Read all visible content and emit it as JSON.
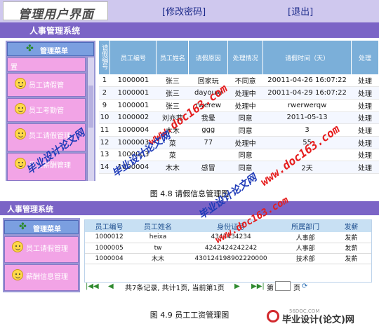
{
  "figure1": {
    "logo_text": "管理用户界面",
    "links": {
      "change_password": "[修改密码]",
      "logout": "[退出]"
    },
    "system_title": "人事管理系统",
    "sidebar": {
      "header": "管理菜单",
      "items": [
        {
          "label": "置"
        },
        {
          "label": "员工请假管"
        },
        {
          "label": "员工考勤管"
        },
        {
          "label": "员工请假管理"
        },
        {
          "label": "员工薪酬管理"
        }
      ]
    },
    "table": {
      "headers": [
        "请假编号",
        "员工编号",
        "员工姓名",
        "请假原因",
        "处理情况",
        "请假时间（天）",
        "处理"
      ],
      "rows": [
        [
          "1",
          "1000001",
          "张三",
          "回家玩",
          "不同意",
          "20011-04-26 16:07:22",
          "处理"
        ],
        [
          "2",
          "1000001",
          "张三",
          "dayouxi",
          "处理中",
          "20011-04-29 16:07:22",
          "处理"
        ],
        [
          "9",
          "1000001",
          "张三",
          "rwerew",
          "处理中",
          "rwerwerqw",
          "处理"
        ],
        [
          "10",
          "1000002",
          "刘亦菲",
          "我晕",
          "同意",
          "2011-05-13",
          "处理"
        ],
        [
          "11",
          "1000004",
          "木木",
          "ggg",
          "同意",
          "3",
          "处理"
        ],
        [
          "12",
          "1000003",
          "菜",
          "77",
          "处理中",
          "55",
          "处理"
        ],
        [
          "13",
          "1000003",
          "菜",
          "",
          "同意",
          "",
          "处理"
        ],
        [
          "14",
          "1000004",
          "木木",
          "感冒",
          "同意",
          "2天",
          "处理"
        ]
      ]
    },
    "caption": "图 4.8  请假信息管理图"
  },
  "figure2": {
    "system_title": "人事管理系统",
    "sidebar": {
      "header": "管理菜单",
      "items": [
        {
          "label": "员工请假管理"
        },
        {
          "label": "薪酬信息管理"
        }
      ]
    },
    "table": {
      "headers": [
        "员工编号",
        "员工姓名",
        "身份证号",
        "所属部门",
        "发薪"
      ],
      "rows": [
        [
          "1000012",
          "heixa",
          "4343434234",
          "人事部",
          "发薪"
        ],
        [
          "1000005",
          "tw",
          "4242424242242",
          "人事部",
          "发薪"
        ],
        [
          "1000004",
          "木木",
          "430124198902220000",
          "技术部",
          "发薪"
        ]
      ]
    },
    "pager": {
      "status": "共7条记录, 共计1页, 当前第1页",
      "goto_label": "第",
      "page_suffix": "页"
    },
    "caption": "图 4.9  员工工资管理图"
  },
  "watermarks": [
    "毕业设计论文网",
    "www.doc163.com"
  ],
  "brand": {
    "small": "56DOC.COM",
    "big": "毕业设计(论文)网"
  }
}
